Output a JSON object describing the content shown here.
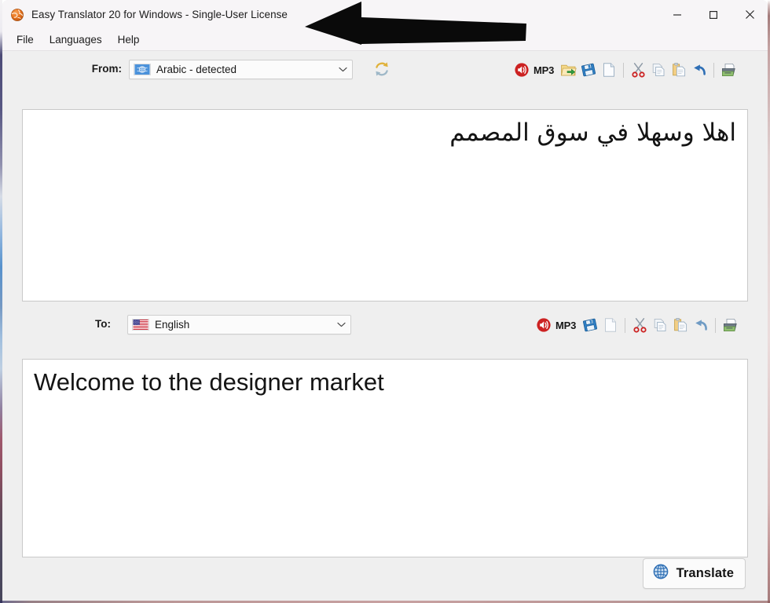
{
  "window": {
    "title": "Easy Translator 20 for Windows - Single-User License",
    "app_icon": "globe-orange-icon",
    "controls": {
      "minimize": "minimize-icon",
      "maximize": "maximize-icon",
      "close": "close-icon"
    }
  },
  "menubar": {
    "items": [
      {
        "label": "File"
      },
      {
        "label": "Languages"
      },
      {
        "label": "Help"
      }
    ]
  },
  "source": {
    "label": "From:",
    "language": "Arabic - detected",
    "flag": "un-flag-icon",
    "refresh_icon": "refresh-icon",
    "text": "اهلا وسهلا في سوق المصمم",
    "toolbar": [
      {
        "name": "speak-icon",
        "label": ""
      },
      {
        "name": "mp3-label",
        "label": "MP3"
      },
      {
        "name": "open-file-icon",
        "label": ""
      },
      {
        "name": "save-icon",
        "label": ""
      },
      {
        "name": "new-document-icon",
        "label": ""
      },
      {
        "name": "cut-icon",
        "label": ""
      },
      {
        "name": "copy-icon",
        "label": ""
      },
      {
        "name": "paste-icon",
        "label": ""
      },
      {
        "name": "undo-icon",
        "label": ""
      },
      {
        "name": "print-icon",
        "label": ""
      }
    ]
  },
  "target": {
    "label": "To:",
    "language": "English",
    "flag": "us-flag-icon",
    "text": "Welcome to the designer market",
    "toolbar": [
      {
        "name": "speak-icon",
        "label": ""
      },
      {
        "name": "mp3-label",
        "label": "MP3"
      },
      {
        "name": "save-icon",
        "label": ""
      },
      {
        "name": "new-document-icon",
        "label": ""
      },
      {
        "name": "cut-icon",
        "label": ""
      },
      {
        "name": "copy-icon",
        "label": ""
      },
      {
        "name": "paste-icon",
        "label": ""
      },
      {
        "name": "undo-icon",
        "label": ""
      },
      {
        "name": "print-icon",
        "label": ""
      }
    ]
  },
  "actions": {
    "translate_label": "Translate",
    "translate_icon": "globe-blue-icon"
  },
  "annotation": {
    "arrow": "black-left-arrow-annotation"
  },
  "colors": {
    "window_background": "#efefef",
    "titlebar": "#f7f5f7",
    "textarea": "#ffffff",
    "border": "#c9c9c9",
    "accent_red": "#cc2222",
    "accent_blue": "#2a6fb5",
    "accent_yellow": "#e9b949"
  }
}
